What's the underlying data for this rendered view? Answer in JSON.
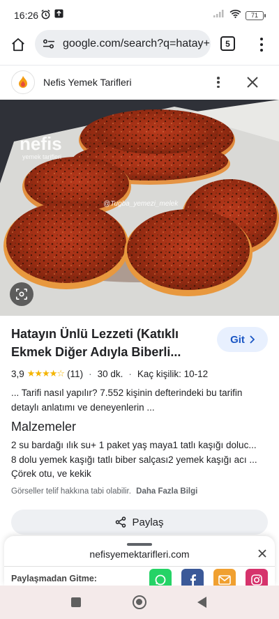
{
  "status_bar": {
    "time": "16:26",
    "battery": "71"
  },
  "browser": {
    "url": "google.com/search?q=hatay+",
    "tab_count": "5"
  },
  "sheet": {
    "site_name": "Nefis Yemek Tarifleri"
  },
  "image": {
    "watermark_brand": "nefis",
    "watermark_sub": "yemek tarifleri",
    "credit": "@Tugba_yemezi_melek"
  },
  "result": {
    "title": "Hatayın Ünlü Lezzeti (Katıklı Ekmek Diğer Adıyla Biberli...",
    "go_label": "Git",
    "rating": "3,9",
    "stars": "★★★★☆",
    "reviews": "(11)",
    "time": "30 dk.",
    "servings": "Kaç kişilik: 10-12",
    "snippet": "... Tarifi nasıl yapılır? 7.552 kişinin defterindeki bu tarifin detaylı anlatımı ve deneyenlerin ...",
    "ingredients_heading": "Malzemeler",
    "ingredients": [
      "2 su bardağı ılık su+ 1 paket yaş maya1 tatlı kaşığı doluc...",
      "8 dolu yemek kaşığı tatlı biber salçası2 yemek kaşığı acı ...",
      "Çörek otu, ve kekik"
    ],
    "copyright": "Görseller telif hakkına tabi olabilir.",
    "more_info": "Daha Fazla Bilgi",
    "share_label": "Paylaş"
  },
  "share_sheet": {
    "domain": "nefisyemektarifleri.com",
    "label": "Paylaşmadan Gitme:",
    "apps": [
      "whatsapp-icon",
      "facebook-icon",
      "email-icon",
      "instagram-icon"
    ]
  },
  "colors": {
    "accent": "#1a56c4",
    "accent_bg": "#e8f0fe",
    "star": "#f4b400",
    "whatsapp": "#25d366",
    "facebook": "#3b5998",
    "email": "#f0a030",
    "instagram": "#d6336c"
  }
}
